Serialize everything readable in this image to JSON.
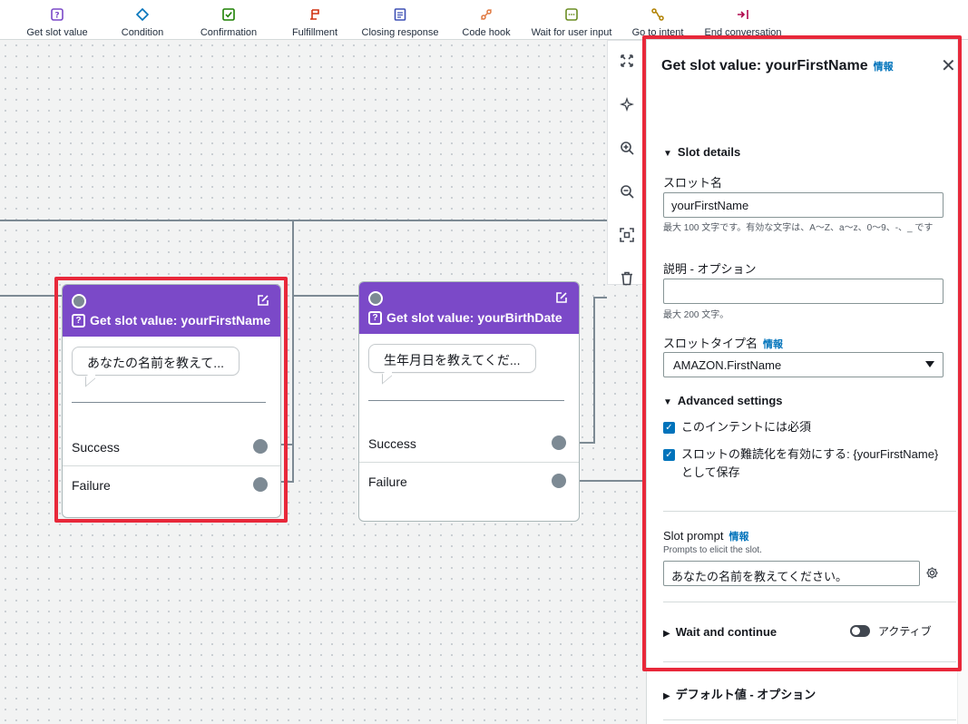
{
  "toolbar": {
    "items": [
      {
        "label": "Get slot value",
        "icon": "question-box-icon",
        "color": "#7b49c8"
      },
      {
        "label": "Condition",
        "icon": "diamond-icon",
        "color": "#0073bb"
      },
      {
        "label": "Confirmation",
        "icon": "check-box-icon",
        "color": "#1d8102"
      },
      {
        "label": "Fulfillment",
        "icon": "flag-icon",
        "color": "#d13212"
      },
      {
        "label": "Closing response",
        "icon": "document-icon",
        "color": "#3f51b5"
      },
      {
        "label": "Code hook",
        "icon": "code-hook-icon",
        "color": "#e07941"
      },
      {
        "label": "Wait for user input",
        "icon": "dots-box-icon",
        "color": "#6b8e23"
      },
      {
        "label": "Go to intent",
        "icon": "route-icon",
        "color": "#b08000"
      },
      {
        "label": "End conversation",
        "icon": "exit-icon",
        "color": "#b0084d"
      }
    ]
  },
  "nodes": [
    {
      "title": "Get slot value: yourFirstName",
      "prompt": "あなたの名前を教えて...",
      "success": "Success",
      "failure": "Failure"
    },
    {
      "title": "Get slot value: yourBirthDate",
      "prompt": "生年月日を教えてくだ...",
      "success": "Success",
      "failure": "Failure"
    }
  ],
  "panel": {
    "title": "Get slot value: yourFirstName",
    "info": "情報",
    "slot_details": "Slot details",
    "slot_name_label": "スロット名",
    "slot_name_value": "yourFirstName",
    "slot_name_hint": "最大 100 文字です。有効な文字は、A〜Z、a〜z、0〜9、-、_ です",
    "desc_label": "説明 - オプション",
    "desc_value": "",
    "desc_hint": "最大 200 文字。",
    "slot_type_label": "スロットタイプ名",
    "slot_type_value": "AMAZON.FirstName",
    "advanced": "Advanced settings",
    "required_label": "このインテントには必須",
    "obfuscate_label": "スロットの難読化を有効にする: {yourFirstName} として保存",
    "slot_prompt_label": "Slot prompt",
    "slot_prompt_hint": "Prompts to elicit the slot.",
    "slot_prompt_value": "あなたの名前を教えてください。",
    "wait_continue": "Wait and continue",
    "wait_status": "アクティブ",
    "default_value": "デフォルト値 - オプション"
  }
}
